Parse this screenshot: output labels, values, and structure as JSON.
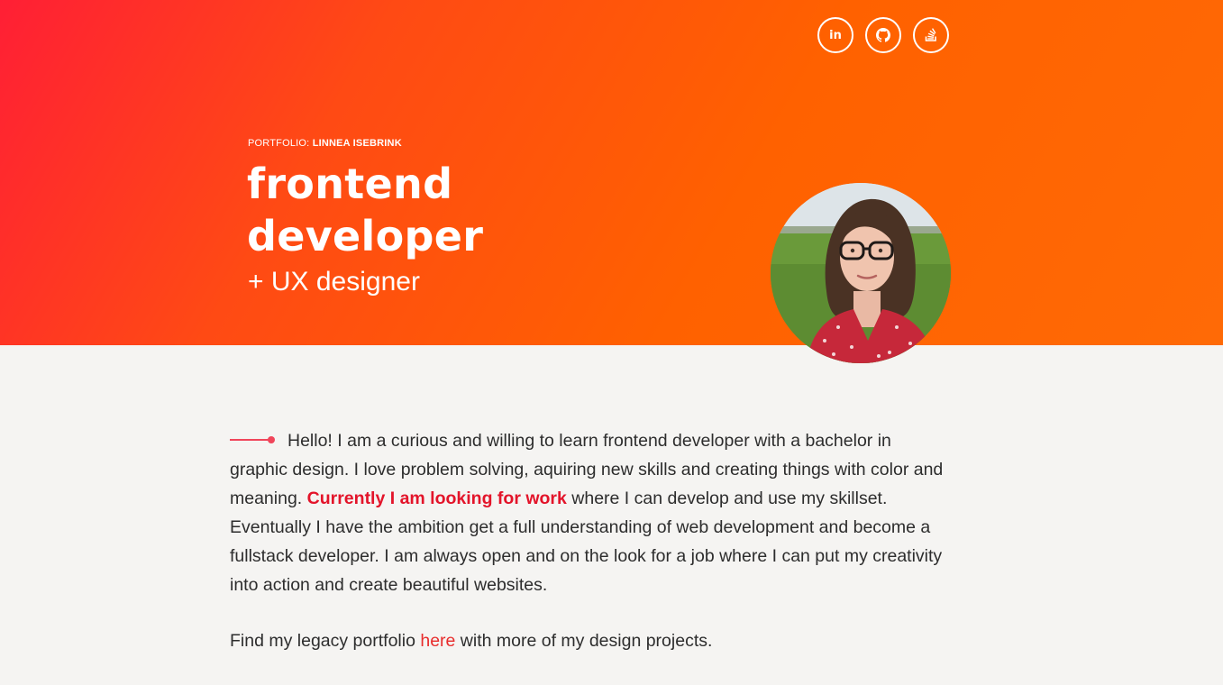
{
  "hero": {
    "eyebrow_prefix": "PORTFOLIO: ",
    "eyebrow_name": "LINNEA ISEBRINK",
    "title_line1": "frontend",
    "title_line2": "developer",
    "subtitle": "+ UX designer"
  },
  "socials": [
    {
      "icon": "linkedin-icon",
      "label": "in"
    },
    {
      "icon": "github-icon"
    },
    {
      "icon": "stackoverflow-icon"
    }
  ],
  "intro": {
    "text_before": "Hello! I am a curious and willing to learn frontend developer with a bachelor in graphic design. I love problem solving, aquiring new skills and creating things with color and meaning. ",
    "highlight": "Currently I am looking for work",
    "text_after": " where I can develop and use my skillset. Eventually I have the ambition get a full understanding of web development and become a fullstack developer. I am always open and on the look for a job where I can put my creativity into action and create beautiful websites."
  },
  "legacy": {
    "text_before": "Find my legacy portfolio ",
    "link_text": "here",
    "text_after": " with more of my design projects."
  },
  "colors": {
    "accent": "#e3142a",
    "hero_start": "#ff1f35",
    "hero_end": "#ff6a06",
    "background": "#f5f4f2"
  }
}
